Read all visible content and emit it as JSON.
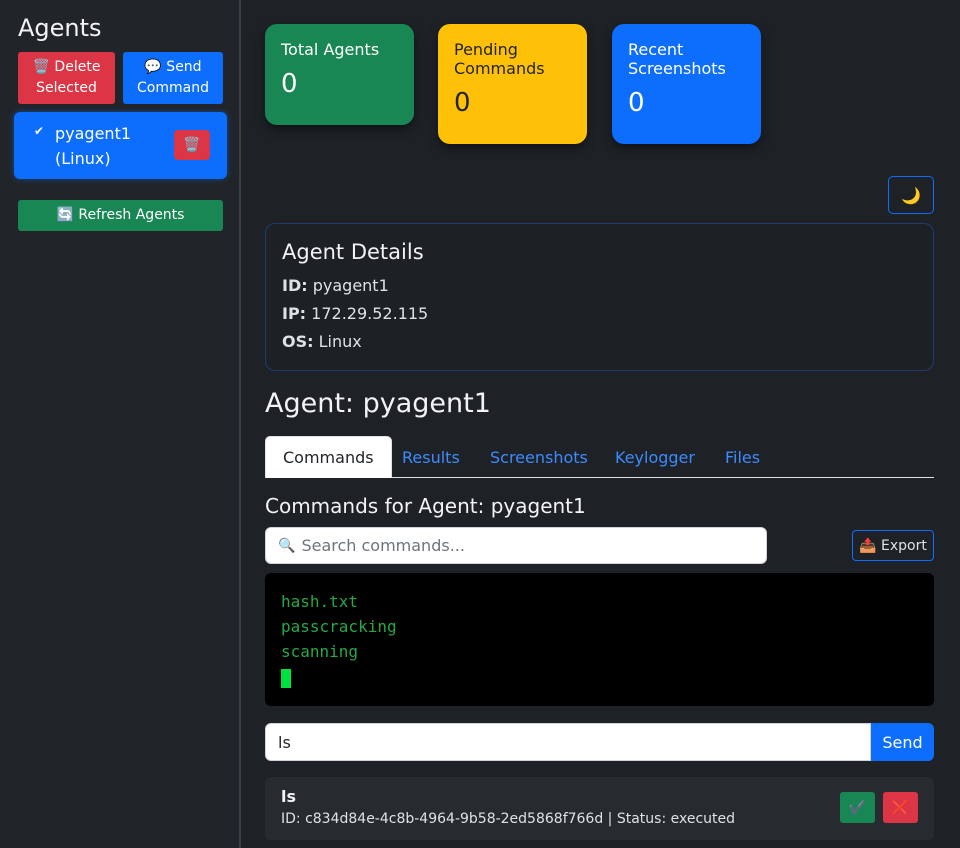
{
  "sidebar": {
    "title": "Agents",
    "delete_selected": "🗑️ Delete Selected",
    "send_command": "💬 Send Command",
    "agents": [
      {
        "label": "pyagent1 (Linux)",
        "check": "✔",
        "delete_icon": "🗑️"
      }
    ],
    "refresh": "🔄 Refresh Agents"
  },
  "stats": {
    "total_label": "Total Agents",
    "total_value": "0",
    "pending_label": "Pending Commands",
    "pending_value": "0",
    "shots_label": "Recent Screenshots",
    "shots_value": "0"
  },
  "theme_toggle": "🌙",
  "details": {
    "title": "Agent Details",
    "id_label": "ID:",
    "id_value": "pyagent1",
    "ip_label": "IP:",
    "ip_value": "172.29.52.115",
    "os_label": "OS:",
    "os_value": "Linux"
  },
  "agent_heading": "Agent: pyagent1",
  "tabs": [
    "Commands",
    "Results",
    "Screenshots",
    "Keylogger",
    "Files"
  ],
  "commands": {
    "heading": "Commands for Agent: pyagent1",
    "search_icon": "🔍",
    "search_placeholder": "Search commands...",
    "export": "📤 Export",
    "terminal_lines": [
      "hash.txt",
      "passcracking",
      "scanning"
    ],
    "input_value": "ls",
    "send": "Send",
    "items": [
      {
        "name": "ls",
        "meta": "ID: c834d84e-4c8b-4964-9b58-2ed5868f766d | Status: executed",
        "ok_icon": "✔️",
        "cancel_icon": "❌"
      }
    ]
  },
  "colors": {
    "success": "#198754",
    "warning": "#ffc107",
    "primary": "#0d6efd",
    "danger": "#dc3545"
  }
}
